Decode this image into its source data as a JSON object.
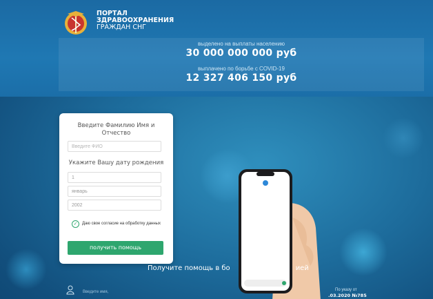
{
  "header": {
    "title_line1": "ПОРТАЛ",
    "title_line2": "ЗДРАВООХРАНЕНИЯ",
    "title_line3": "ГРАЖДАН СНГ",
    "logo_icon": "caduceus-emblem-icon"
  },
  "stats": {
    "allocated_label": "выделено на выплаты населению",
    "allocated_value": "30 000 000 000 руб",
    "paid_label": "выплачено по борьбе с COVID-19",
    "paid_value": "12 327 406 150 руб"
  },
  "form": {
    "name_heading": "Введите Фамилию Имя и Отчество",
    "name_placeholder": "Введите ФИО",
    "dob_heading": "Укажите Вашу дату рождения",
    "day_value": "1",
    "month_value": "январь",
    "year_value": "2002",
    "consent_text": "Даю свое согласие на обработку данных",
    "submit_label": "получить помощь"
  },
  "tagline_left": "Получите помощь в бо",
  "tagline_right": "ией",
  "footer": {
    "hint": "Введите имя,",
    "decree_line1": "По указу от",
    "decree_line2": ".03.2020 №785"
  },
  "colors": {
    "accent_green": "#2ea66e",
    "header_blue": "#1f78b3",
    "background_blue": "#1d6c9c"
  }
}
